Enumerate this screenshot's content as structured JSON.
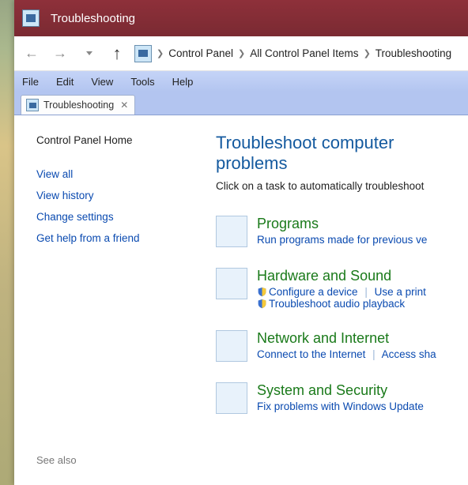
{
  "window": {
    "title": "Troubleshooting"
  },
  "breadcrumb": {
    "items": [
      "Control Panel",
      "All Control Panel Items",
      "Troubleshooting"
    ]
  },
  "menu": {
    "file": "File",
    "edit": "Edit",
    "view": "View",
    "tools": "Tools",
    "help": "Help"
  },
  "tab": {
    "label": "Troubleshooting"
  },
  "sidebar": {
    "home": "Control Panel Home",
    "view_all": "View all",
    "view_history": "View history",
    "change_settings": "Change settings",
    "get_help": "Get help from a friend",
    "see_also": "See also"
  },
  "main": {
    "heading": "Troubleshoot computer problems",
    "subtext": "Click on a task to automatically troubleshoot",
    "categories": {
      "programs": {
        "title": "Programs",
        "link1": "Run programs made for previous ve"
      },
      "hardware": {
        "title": "Hardware and Sound",
        "link1": "Configure a device",
        "link2": "Use a print",
        "link3": "Troubleshoot audio playback"
      },
      "network": {
        "title": "Network and Internet",
        "link1": "Connect to the Internet",
        "link2": "Access sha"
      },
      "system": {
        "title": "System and Security",
        "link1": "Fix problems with Windows Update"
      }
    }
  }
}
